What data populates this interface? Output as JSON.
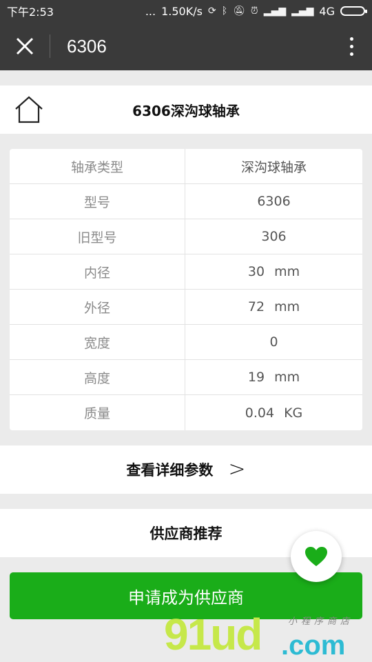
{
  "status_bar": {
    "time": "下午2:53",
    "dots": "...",
    "speed": "1.50K/s",
    "network": "4G"
  },
  "title_bar": {
    "title": "6306"
  },
  "product": {
    "title": "6306深沟球轴承"
  },
  "specs": [
    {
      "label": "轴承类型",
      "value": "深沟球轴承",
      "unit": ""
    },
    {
      "label": "型号",
      "value": "6306",
      "unit": ""
    },
    {
      "label": "旧型号",
      "value": "306",
      "unit": ""
    },
    {
      "label": "内径",
      "value": "30",
      "unit": "mm"
    },
    {
      "label": "外径",
      "value": "72",
      "unit": "mm"
    },
    {
      "label": "宽度",
      "value": "0",
      "unit": ""
    },
    {
      "label": "高度",
      "value": "19",
      "unit": "mm"
    },
    {
      "label": "质量",
      "value": "0.04",
      "unit": "KG"
    }
  ],
  "detail_link": {
    "label": "查看详细参数",
    "chevron": ">"
  },
  "supplier": {
    "title": "供应商推荐"
  },
  "apply_button": {
    "label": "申请成为供应商"
  },
  "watermark": {
    "brand": "91ud",
    "domain": ".com",
    "tagline": "小程序商店"
  },
  "colors": {
    "title_bar": "#3a3a3a",
    "primary_green": "#1aad19",
    "heart": "#1aad19",
    "background": "#ebebeb"
  },
  "icons": {
    "close": "close-icon",
    "more": "more-vertical-icon",
    "home": "home-icon",
    "favorite": "heart-icon"
  }
}
